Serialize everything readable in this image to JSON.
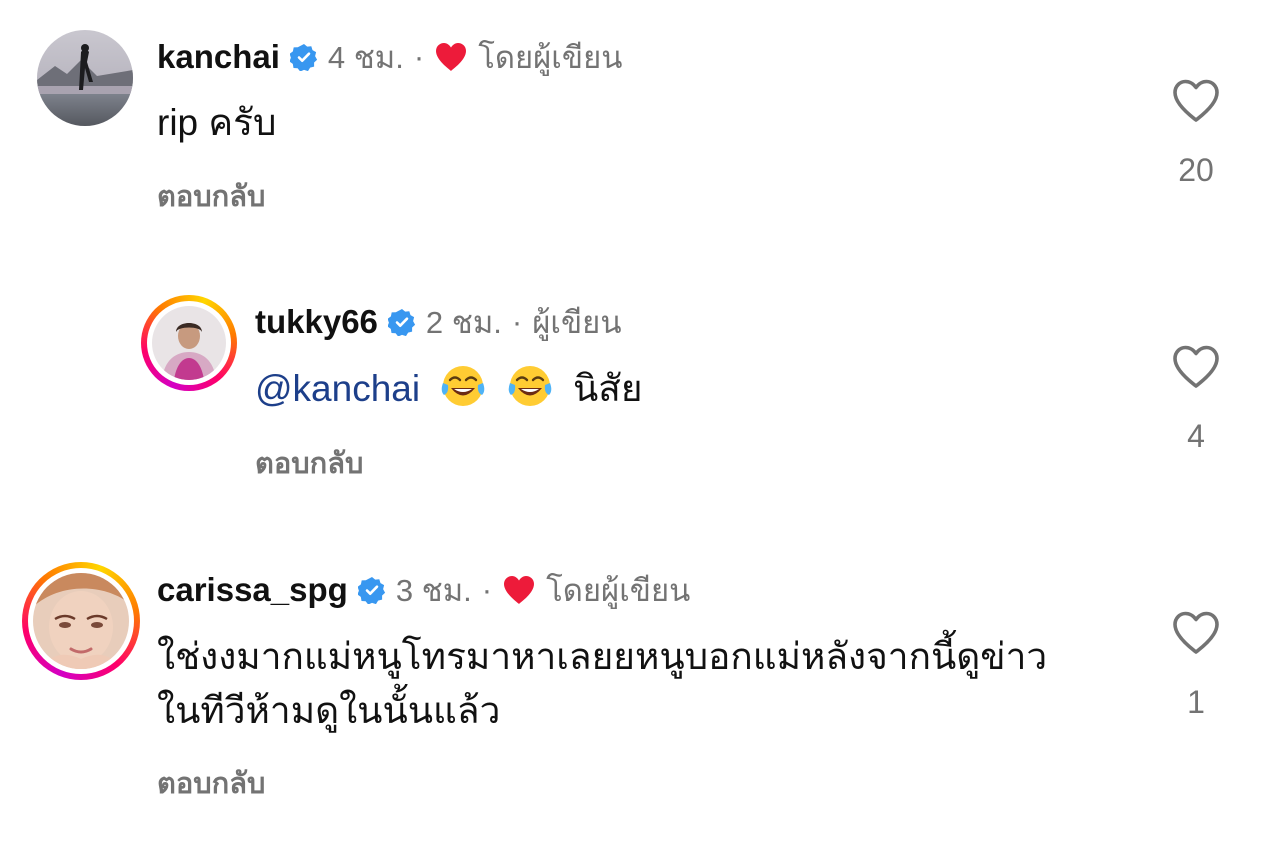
{
  "comments": [
    {
      "username": "kanchai",
      "time": "4 ชม.",
      "separator": "·",
      "author_tag": "โดยผู้เขียน",
      "text": "rip ครับ",
      "reply_label": "ตอบกลับ",
      "likes": "20",
      "liked_by_author": true
    },
    {
      "username": "tukky66",
      "time": "2 ชม.",
      "separator": "·",
      "author_tag": "ผู้เขียน",
      "mention": "@kanchai",
      "text_suffix": "นิสัย",
      "emoji": [
        "face-with-tears-of-joy",
        "face-with-tears-of-joy"
      ],
      "reply_label": "ตอบกลับ",
      "likes": "4",
      "liked_by_author": false
    },
    {
      "username": "carissa_spg",
      "time": "3 ชม.",
      "separator": "·",
      "author_tag": "โดยผู้เขียน",
      "text_line1": "ใช่งงมากแม่หนูโทรมาหาเลยยหนูบอกแม่หลังจากนี้ดูข่าว",
      "text_line2": "ในทีวีห้ามดูในนั้นแล้ว",
      "reply_label": "ตอบกลับ",
      "likes": "1",
      "liked_by_author": true
    }
  ],
  "colors": {
    "verified": "#3897f0",
    "heart_red": "#ed1b3a",
    "secondary_text": "#737373",
    "mention": "#1d3f8a"
  }
}
